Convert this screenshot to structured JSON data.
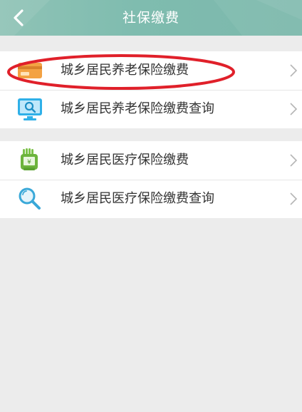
{
  "header": {
    "title": "社保缴费",
    "back_icon": "back-chevron-icon"
  },
  "groups": [
    {
      "items": [
        {
          "label": "城乡居民养老保险缴费",
          "icon": "card-icon",
          "highlighted": true
        },
        {
          "label": "城乡居民养老保险缴费查询",
          "icon": "monitor-search-icon"
        }
      ]
    },
    {
      "items": [
        {
          "label": "城乡居民医疗保险缴费",
          "icon": "payment-hand-icon"
        },
        {
          "label": "城乡居民医疗保险缴费查询",
          "icon": "magnifier-icon"
        }
      ]
    }
  ],
  "colors": {
    "header": "#7fbcaf",
    "background": "#ececec",
    "highlight_oval": "#e0202a"
  }
}
